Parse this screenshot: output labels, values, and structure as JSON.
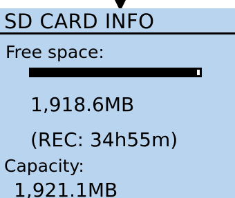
{
  "screen": {
    "title": "SD CARD INFO",
    "free_space_label": "Free space:",
    "free_space_fraction": 0.987,
    "free_space_value": "1,918.6MB",
    "rec_time": "(REC: 34h55m)",
    "capacity_label": "Capacity:",
    "capacity_value": "1,921.1MB"
  },
  "colors": {
    "screen_background": "#b8d4ef",
    "text": "#000000"
  },
  "icons": {
    "pointer": "down-triangle-icon"
  }
}
